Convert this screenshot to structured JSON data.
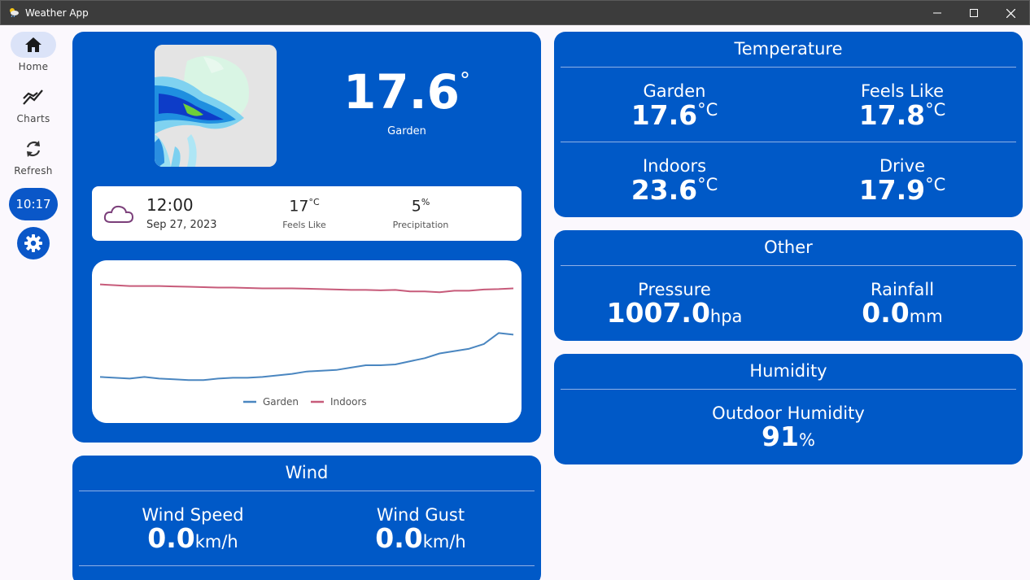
{
  "window": {
    "title": "Weather App"
  },
  "nav": {
    "home": "Home",
    "charts": "Charts",
    "refresh": "Refresh",
    "time": "10:17"
  },
  "current": {
    "temperature": "17.6",
    "degree_symbol": "°",
    "location": "Garden"
  },
  "forecast": {
    "time": "12:00",
    "date": "Sep 27, 2023",
    "feels_like_value": "17",
    "feels_like_unit": "°C",
    "feels_like_label": "Feels Like",
    "precip_value": "5",
    "precip_unit": "%",
    "precip_label": "Precipitation",
    "icon": "cloud-icon"
  },
  "chart_data": {
    "type": "line",
    "series": [
      {
        "name": "Garden",
        "color": "#4a86c0",
        "values": [
          12.2,
          12.1,
          12.0,
          12.2,
          12.0,
          11.9,
          11.8,
          11.8,
          12.0,
          12.1,
          12.1,
          12.2,
          12.4,
          12.6,
          12.9,
          13.0,
          13.1,
          13.4,
          13.7,
          13.7,
          13.8,
          14.2,
          14.6,
          15.2,
          15.5,
          15.8,
          16.4,
          17.8,
          17.6
        ]
      },
      {
        "name": "Indoors",
        "color": "#c75b7a",
        "values": [
          24.0,
          23.9,
          23.8,
          23.8,
          23.8,
          23.75,
          23.7,
          23.65,
          23.6,
          23.6,
          23.55,
          23.5,
          23.5,
          23.5,
          23.45,
          23.4,
          23.35,
          23.3,
          23.3,
          23.25,
          23.3,
          23.1,
          23.1,
          23.0,
          23.2,
          23.2,
          23.35,
          23.4,
          23.5
        ]
      }
    ],
    "ylim": [
      11,
      25
    ]
  },
  "wind": {
    "title": "Wind",
    "speed_label": "Wind Speed",
    "speed_value": "0.0",
    "speed_unit": "km/h",
    "gust_label": "Wind Gust",
    "gust_value": "0.0",
    "gust_unit": "km/h"
  },
  "temperature": {
    "title": "Temperature",
    "garden_label": "Garden",
    "garden_value": "17.6",
    "garden_unit": "°C",
    "feels_label": "Feels Like",
    "feels_value": "17.8",
    "feels_unit": "°C",
    "indoors_label": "Indoors",
    "indoors_value": "23.6",
    "indoors_unit": "°C",
    "drive_label": "Drive",
    "drive_value": "17.9",
    "drive_unit": "°C"
  },
  "other": {
    "title": "Other",
    "pressure_label": "Pressure",
    "pressure_value": "1007.0",
    "pressure_unit": "hpa",
    "rainfall_label": "Rainfall",
    "rainfall_value": "0.0",
    "rainfall_unit": "mm"
  },
  "humidity": {
    "title": "Humidity",
    "outdoor_label": "Outdoor Humidity",
    "outdoor_value": "91",
    "outdoor_unit": "%"
  },
  "colors": {
    "primary": "#0059c7",
    "nav_active": "#dbe3f8",
    "background": "#fbf8fd"
  }
}
